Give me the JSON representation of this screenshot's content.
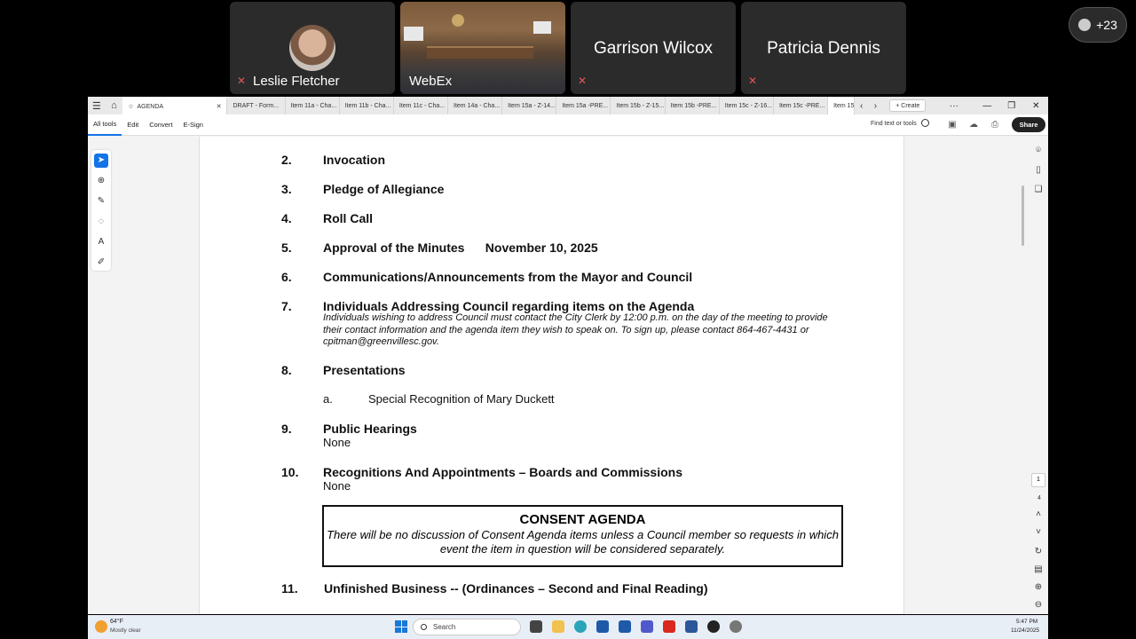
{
  "participants": [
    {
      "name": "Leslie Fletcher"
    },
    {
      "name": "WebEx"
    },
    {
      "name": "Garrison Wilcox"
    },
    {
      "name": "Patricia Dennis"
    }
  ],
  "more_participants": "+23",
  "acrobat": {
    "tabs": [
      "AGENDA",
      "DRAFT - Form...",
      "Item 11a - Cha...",
      "Item 11b - Cha...",
      "Item 11c - Cha...",
      "Item 14a - Cha...",
      "Item 15a - Z-14...",
      "Item 15a -PRE...",
      "Item 15b - Z-15...",
      "Item 15b -PRE...",
      "Item 15c - Z-16...",
      "Item 15c -PRE...",
      "Item 15"
    ],
    "create_label": "Create",
    "menus": [
      "All tools",
      "Edit",
      "Convert",
      "E-Sign"
    ],
    "find_placeholder": "Find text or tools",
    "share_label": "Share",
    "page_current": "1",
    "page_total": "4"
  },
  "agenda": {
    "items": [
      {
        "num": "2.",
        "label": "Invocation"
      },
      {
        "num": "3.",
        "label": "Pledge of Allegiance"
      },
      {
        "num": "4.",
        "label": "Roll Call"
      },
      {
        "num": "5.",
        "label": "Approval of the Minutes      November 10, 2025"
      },
      {
        "num": "6.",
        "label": "Communications/Announcements from the Mayor and Council"
      },
      {
        "num": "7.",
        "label": "Individuals Addressing Council regarding items on the Agenda"
      },
      {
        "num": "8.",
        "label": "Presentations"
      },
      {
        "num": "9.",
        "label": "Public Hearings"
      },
      {
        "num": "10.",
        "label": "Recognitions And Appointments – Boards and Commissions"
      },
      {
        "num": "11.",
        "label": "Unfinished Business -- (Ordinances – Second and Final Reading)"
      }
    ],
    "item7_note": "Individuals wishing to address Council must contact the City Clerk by 12:00 p.m. on the day of the meeting to provide their contact information and the agenda item they wish to speak on. To sign up, please contact 864-467-4431 or cpitman@greenvillesc.gov.",
    "item8_sub_letter": "a.",
    "item8_sub_text": "Special Recognition of Mary Duckett",
    "item9_sub": "None",
    "item10_sub": "None",
    "consent_title": "CONSENT AGENDA",
    "consent_body": "There will be no discussion of Consent Agenda items unless a Council member so requests in which event the item in question will be considered separately."
  },
  "taskbar": {
    "temperature": "64°F",
    "weather": "Mostly clear",
    "search_placeholder": "Search",
    "time": "5:47 PM",
    "date": "11/24/2025"
  }
}
